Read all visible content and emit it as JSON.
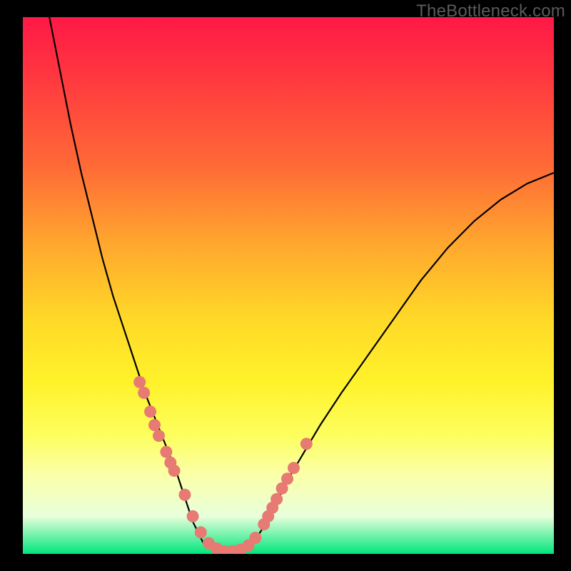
{
  "watermark": "TheBottleneck.com",
  "colors": {
    "frame": "#000000",
    "curve": "#000000",
    "dot_fill": "#e77a72",
    "dot_stroke": "#c65a52"
  },
  "chart_data": {
    "type": "line",
    "title": "",
    "xlabel": "",
    "ylabel": "",
    "xlim": [
      0,
      100
    ],
    "ylim": [
      0,
      100
    ],
    "series": [
      {
        "name": "bottleneck-curve",
        "x": [
          5,
          7,
          9,
          11,
          13,
          15,
          17,
          19,
          21,
          23,
          25,
          27,
          29,
          30,
          31,
          32,
          33,
          34,
          36,
          38,
          40,
          42,
          44,
          46,
          48,
          50,
          53,
          56,
          60,
          65,
          70,
          75,
          80,
          85,
          90,
          95,
          100
        ],
        "y": [
          100,
          90,
          80,
          71,
          63,
          55,
          48,
          42,
          36,
          30,
          25,
          20,
          15,
          12,
          9,
          6,
          4,
          2,
          1,
          0,
          0,
          1,
          3,
          6,
          10,
          14,
          19,
          24,
          30,
          37,
          44,
          51,
          57,
          62,
          66,
          69,
          71
        ]
      }
    ],
    "dots": {
      "name": "highlighted-points",
      "x": [
        22.0,
        22.8,
        24.0,
        24.8,
        25.6,
        27.0,
        27.8,
        28.5,
        30.5,
        32.0,
        33.5,
        35.0,
        36.5,
        38.0,
        39.5,
        41.0,
        42.5,
        43.8,
        45.4,
        46.2,
        47.0,
        47.8,
        48.8,
        49.8,
        51.0,
        53.4
      ],
      "y": [
        32.0,
        30.0,
        26.5,
        24.0,
        22.0,
        19.0,
        17.0,
        15.5,
        11.0,
        7.0,
        4.0,
        2.0,
        1.0,
        0.5,
        0.5,
        0.8,
        1.6,
        3.0,
        5.5,
        7.0,
        8.6,
        10.2,
        12.2,
        14.0,
        16.0,
        20.5
      ]
    }
  }
}
